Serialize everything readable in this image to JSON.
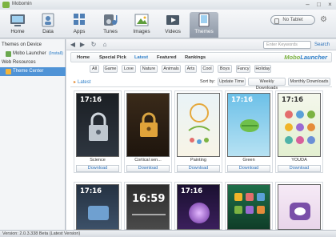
{
  "app": {
    "title": "Mobomin"
  },
  "toolbar": {
    "items": [
      {
        "label": "Home"
      },
      {
        "label": "Data"
      },
      {
        "label": "Apps"
      },
      {
        "label": "Tunes"
      },
      {
        "label": "Images"
      },
      {
        "label": "Videos"
      },
      {
        "label": "Themes"
      }
    ],
    "active_item": "Themes",
    "device_button": "No Tablet"
  },
  "sidebar": {
    "section_device": "Themes on Device",
    "device_item": {
      "label": "Mobo Launcher",
      "count": "(Install)"
    },
    "section_web": "Web Resources",
    "web_item": {
      "label": "Theme Center"
    }
  },
  "navbar": {
    "search_placeholder": "Enter Keywords",
    "search_button": "Search"
  },
  "tabs": [
    {
      "label": "Home"
    },
    {
      "label": "Special Pick"
    },
    {
      "label": "Latest"
    },
    {
      "label": "Featured"
    },
    {
      "label": "Rankings"
    }
  ],
  "active_tab": "Latest",
  "brand": {
    "part1": "Mobo",
    "part2": "Launcher"
  },
  "categories": [
    "All",
    "Game",
    "Love",
    "Nature",
    "Animals",
    "Arts",
    "Cool",
    "Boys",
    "Fancy",
    "Holiday"
  ],
  "list": {
    "heading": "Latest",
    "sort_label": "Sort by:",
    "sort_options": [
      "Update Time",
      "Weekly Downloads",
      "Monthly Downloads"
    ]
  },
  "themes_row1": [
    {
      "name": "Science",
      "clock": "17:16",
      "download": "Download"
    },
    {
      "name": "Cortical sen...",
      "clock": "",
      "download": "Download"
    },
    {
      "name": "Painting",
      "clock": "",
      "download": "Download"
    },
    {
      "name": "Green",
      "clock": "17:16",
      "download": "Download"
    },
    {
      "name": "YOUDA",
      "clock": "17:16",
      "download": "Download"
    }
  ],
  "themes_row2": [
    {
      "clock": "17:16"
    },
    {
      "clock": "16:59"
    },
    {
      "clock": "17:16"
    },
    {
      "clock": ""
    },
    {
      "clock": ""
    }
  ],
  "status": {
    "version": "Version: 2.0.3.338 Beta  (Latest Version)"
  },
  "colors": {
    "accent": "#2a7cc7",
    "selected": "#4f93d6",
    "brand_green": "#7cb342"
  }
}
